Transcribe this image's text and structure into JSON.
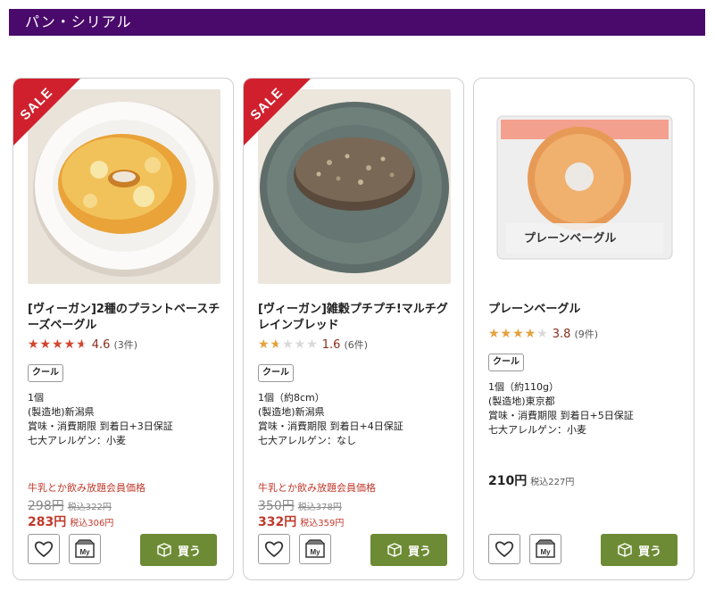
{
  "category": {
    "title": "パン・シリアル"
  },
  "colors": {
    "header_bg": "#4a0a6b",
    "sale": "#d0202e",
    "price_red": "#c0392b",
    "star": "#d4452c",
    "star_gold": "#e6a23c",
    "buy_green": "#6d8b34"
  },
  "products": [
    {
      "sale": true,
      "sale_label": "SALE",
      "title": "[ヴィーガン]2種のプラントベースチーズベーグル",
      "stars_display": "★★★★★",
      "rating_value": "4.6",
      "rating": 4.6,
      "review_count": "(3件)",
      "badge": "クール",
      "specs": [
        "1個",
        "(製造地)新潟県",
        "賞味・消費期限 到着日+3日保証",
        "七大アレルゲン：小麦"
      ],
      "promo_label": "牛乳とか飲み放題会員価格",
      "old_price": "298円",
      "old_price_tax": "税込322円",
      "price": "283円",
      "price_tax": "税込306円",
      "buy_label": "買う",
      "mylist_label": "My"
    },
    {
      "sale": true,
      "sale_label": "SALE",
      "title": "[ヴィーガン]雑穀プチプチ!マルチグレインブレッド",
      "stars_display": "★★★★★",
      "rating_value": "1.6",
      "rating": 1.6,
      "review_count": "(6件)",
      "badge": "クール",
      "specs": [
        "1個（約8cm）",
        "(製造地)新潟県",
        "賞味・消費期限 到着日+4日保証",
        "七大アレルゲン：なし"
      ],
      "promo_label": "牛乳とか飲み放題会員価格",
      "old_price": "350円",
      "old_price_tax": "税込378円",
      "price": "332円",
      "price_tax": "税込359円",
      "buy_label": "買う",
      "mylist_label": "My"
    },
    {
      "sale": false,
      "title": "プレーンベーグル",
      "stars_display": "★★★★★",
      "rating_value": "3.8",
      "rating": 3.8,
      "review_count": "(9件)",
      "badge": "クール",
      "specs": [
        "1個（約110g）",
        "(製造地)東京都",
        "賞味・消費期限 到着日+5日保証",
        "七大アレルゲン：小麦"
      ],
      "price": "210円",
      "price_tax": "税込227円",
      "buy_label": "買う",
      "mylist_label": "My",
      "package_label": "プレーンベーグル"
    }
  ]
}
